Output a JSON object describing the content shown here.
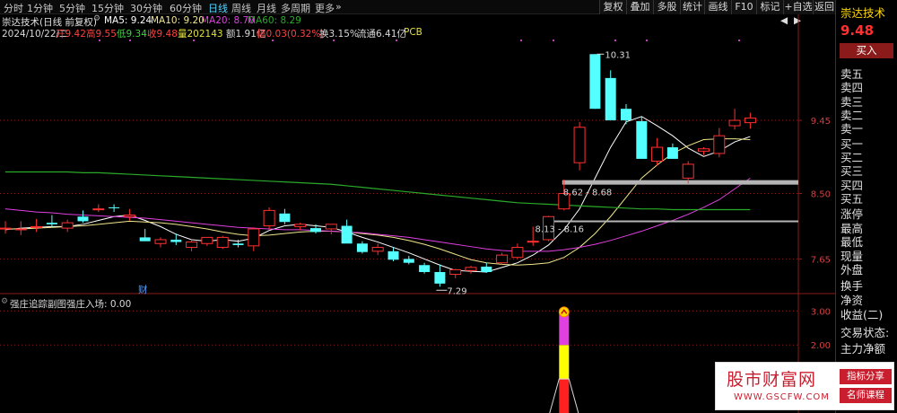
{
  "toolbar": {
    "periods": [
      "分时",
      "1分钟",
      "5分钟",
      "15分钟",
      "30分钟",
      "60分钟",
      "日线",
      "周线",
      "月线",
      "多周期",
      "更多"
    ],
    "active_period": "日线",
    "more_arrow": "»",
    "buttons": [
      "复权",
      "叠加",
      "多股",
      "统计",
      "画线",
      "F10",
      "标记",
      "+自选",
      "返回"
    ],
    "nav_arrows": [
      "◀",
      "▶"
    ]
  },
  "header": {
    "stock": "崇达技术(日线 前复权)",
    "ma5": "MA5: 9.24",
    "ma10": "MA10: 9.20",
    "ma20": "MA20: 8.70",
    "ma60": "MA60: 8.29",
    "date": "2024/10/22/二",
    "open": "开9.42",
    "high": "高9.55",
    "low": "低9.34",
    "close": "收9.48",
    "volume": "量202143",
    "amount": "额1.91亿",
    "change": "幅0.03(0.32%)",
    "turnover": "换3.15%",
    "float": "流通6.41亿",
    "sector": "PCB"
  },
  "chart_data": [
    {
      "type": "candlestick",
      "title": "崇达技术(日线 前复权)",
      "ylim": [
        7.2,
        10.5
      ],
      "y_ticks": [
        "9.45",
        "8.50",
        "7.65"
      ],
      "y_tick_values": [
        9.45,
        8.5,
        7.65
      ],
      "candles": [
        {
          "o": 8.05,
          "h": 8.14,
          "l": 7.98,
          "c": 8.05
        },
        {
          "o": 8.04,
          "h": 8.14,
          "l": 7.96,
          "c": 8.04
        },
        {
          "o": 8.07,
          "h": 8.17,
          "l": 8.0,
          "c": 8.07
        },
        {
          "o": 8.12,
          "h": 8.22,
          "l": 8.06,
          "c": 8.1
        },
        {
          "o": 8.05,
          "h": 8.16,
          "l": 8.0,
          "c": 8.12
        },
        {
          "o": 8.2,
          "h": 8.28,
          "l": 8.12,
          "c": 8.14
        },
        {
          "o": 8.3,
          "h": 8.36,
          "l": 8.26,
          "c": 8.3
        },
        {
          "o": 8.32,
          "h": 8.36,
          "l": 8.26,
          "c": 8.31
        },
        {
          "o": 8.2,
          "h": 8.3,
          "l": 8.15,
          "c": 8.22
        },
        {
          "o": 7.93,
          "h": 8.04,
          "l": 7.9,
          "c": 7.88
        },
        {
          "o": 7.85,
          "h": 7.93,
          "l": 7.8,
          "c": 7.9
        },
        {
          "o": 7.9,
          "h": 7.98,
          "l": 7.83,
          "c": 7.87
        },
        {
          "o": 7.8,
          "h": 7.9,
          "l": 7.75,
          "c": 7.87
        },
        {
          "o": 7.85,
          "h": 7.93,
          "l": 7.82,
          "c": 7.93
        },
        {
          "o": 7.8,
          "h": 7.95,
          "l": 7.78,
          "c": 7.93
        },
        {
          "o": 7.85,
          "h": 7.9,
          "l": 7.8,
          "c": 7.83
        },
        {
          "o": 7.82,
          "h": 8.06,
          "l": 7.75,
          "c": 8.04
        },
        {
          "o": 8.08,
          "h": 8.32,
          "l": 8.03,
          "c": 8.28
        },
        {
          "o": 8.24,
          "h": 8.3,
          "l": 8.1,
          "c": 8.13
        },
        {
          "o": 8.07,
          "h": 8.12,
          "l": 8.02,
          "c": 8.1
        },
        {
          "o": 8.05,
          "h": 8.1,
          "l": 7.98,
          "c": 8.0
        },
        {
          "o": 8.04,
          "h": 8.1,
          "l": 7.97,
          "c": 8.1
        },
        {
          "o": 8.08,
          "h": 8.16,
          "l": 7.9,
          "c": 7.85
        },
        {
          "o": 7.85,
          "h": 7.88,
          "l": 7.72,
          "c": 7.74
        },
        {
          "o": 7.75,
          "h": 7.85,
          "l": 7.7,
          "c": 7.8
        },
        {
          "o": 7.75,
          "h": 7.8,
          "l": 7.62,
          "c": 7.64
        },
        {
          "o": 7.65,
          "h": 7.69,
          "l": 7.58,
          "c": 7.6
        },
        {
          "o": 7.57,
          "h": 7.6,
          "l": 7.46,
          "c": 7.48
        },
        {
          "o": 7.48,
          "h": 7.58,
          "l": 7.29,
          "c": 7.33
        },
        {
          "o": 7.45,
          "h": 7.52,
          "l": 7.4,
          "c": 7.51
        },
        {
          "o": 7.5,
          "h": 7.56,
          "l": 7.46,
          "c": 7.54
        },
        {
          "o": 7.55,
          "h": 7.6,
          "l": 7.47,
          "c": 7.48
        },
        {
          "o": 7.6,
          "h": 7.73,
          "l": 7.58,
          "c": 7.7
        },
        {
          "o": 7.67,
          "h": 7.85,
          "l": 7.65,
          "c": 7.8
        },
        {
          "o": 7.88,
          "h": 8.07,
          "l": 7.82,
          "c": 7.88
        },
        {
          "o": 7.9,
          "h": 8.21,
          "l": 7.88,
          "c": 8.2
        },
        {
          "o": 8.3,
          "h": 8.68,
          "l": 8.28,
          "c": 8.5
        },
        {
          "o": 8.9,
          "h": 9.43,
          "l": 8.8,
          "c": 9.36
        },
        {
          "o": 10.31,
          "h": 10.31,
          "l": 9.6,
          "c": 9.6
        },
        {
          "o": 10.0,
          "h": 10.1,
          "l": 9.45,
          "c": 9.45
        },
        {
          "o": 9.6,
          "h": 9.66,
          "l": 9.4,
          "c": 9.45
        },
        {
          "o": 9.44,
          "h": 9.5,
          "l": 8.95,
          "c": 8.95
        },
        {
          "o": 8.92,
          "h": 9.22,
          "l": 8.86,
          "c": 9.1
        },
        {
          "o": 9.1,
          "h": 9.15,
          "l": 8.95,
          "c": 8.95
        },
        {
          "o": 8.7,
          "h": 8.92,
          "l": 8.63,
          "c": 8.88
        },
        {
          "o": 9.05,
          "h": 9.1,
          "l": 9.0,
          "c": 9.08
        },
        {
          "o": 9.02,
          "h": 9.35,
          "l": 8.97,
          "c": 9.25
        },
        {
          "o": 9.38,
          "h": 9.6,
          "l": 9.33,
          "c": 9.45
        },
        {
          "o": 9.42,
          "h": 9.55,
          "l": 9.34,
          "c": 9.48
        }
      ],
      "ma_series": [
        {
          "name": "MA5",
          "color": "#ffffff",
          "values": [
            8.03,
            8.05,
            8.06,
            8.07,
            8.07,
            8.1,
            8.15,
            8.2,
            8.22,
            8.15,
            8.07,
            7.97,
            7.9,
            7.88,
            7.9,
            7.88,
            7.92,
            8.02,
            8.08,
            8.1,
            8.08,
            8.06,
            8.0,
            7.93,
            7.87,
            7.8,
            7.73,
            7.65,
            7.57,
            7.5,
            7.49,
            7.48,
            7.54,
            7.6,
            7.7,
            7.83,
            8.03,
            8.3,
            8.7,
            9.1,
            9.43,
            9.5,
            9.38,
            9.25,
            9.09,
            8.98,
            9.05,
            9.17,
            9.24
          ]
        },
        {
          "name": "MA10",
          "color": "#f0e68c",
          "values": [
            8.04,
            8.04,
            8.05,
            8.06,
            8.07,
            8.08,
            8.1,
            8.12,
            8.14,
            8.13,
            8.12,
            8.1,
            8.07,
            8.04,
            8.0,
            7.97,
            7.95,
            7.96,
            7.98,
            8.0,
            8.01,
            8.01,
            8.0,
            7.98,
            7.96,
            7.93,
            7.89,
            7.84,
            7.78,
            7.71,
            7.64,
            7.6,
            7.58,
            7.57,
            7.58,
            7.6,
            7.67,
            7.8,
            7.98,
            8.2,
            8.45,
            8.7,
            8.87,
            9.02,
            9.12,
            9.2,
            9.21,
            9.21,
            9.2
          ]
        },
        {
          "name": "MA20",
          "color": "#e040e0",
          "values": [
            8.3,
            8.28,
            8.26,
            8.25,
            8.23,
            8.22,
            8.21,
            8.2,
            8.19,
            8.18,
            8.16,
            8.14,
            8.12,
            8.1,
            8.08,
            8.06,
            8.05,
            8.04,
            8.03,
            8.03,
            8.02,
            8.01,
            8.0,
            7.99,
            7.97,
            7.95,
            7.93,
            7.9,
            7.87,
            7.84,
            7.81,
            7.78,
            7.76,
            7.75,
            7.75,
            7.75,
            7.77,
            7.8,
            7.84,
            7.89,
            7.95,
            8.01,
            8.08,
            8.15,
            8.23,
            8.32,
            8.42,
            8.56,
            8.7
          ]
        },
        {
          "name": "MA60",
          "color": "#2aaa2a",
          "values": [
            8.78,
            8.78,
            8.78,
            8.78,
            8.78,
            8.77,
            8.77,
            8.76,
            8.75,
            8.74,
            8.73,
            8.72,
            8.71,
            8.7,
            8.69,
            8.68,
            8.67,
            8.66,
            8.65,
            8.64,
            8.63,
            8.62,
            8.6,
            8.58,
            8.56,
            8.54,
            8.52,
            8.5,
            8.48,
            8.46,
            8.44,
            8.42,
            8.4,
            8.38,
            8.37,
            8.36,
            8.35,
            8.34,
            8.33,
            8.32,
            8.31,
            8.3,
            8.3,
            8.29,
            8.29,
            8.29,
            8.29,
            8.29,
            8.29
          ]
        }
      ],
      "annotations": [
        "10.31",
        "7.29",
        "8.62 - 8.68",
        "8.13 - 8.16"
      ],
      "levels": [
        8.65,
        8.15
      ],
      "event_marker": "财"
    },
    {
      "type": "bar",
      "title": "强庄追踪副图",
      "subtitle": "强庄入场: 0.00",
      "ylim": [
        0,
        3.3
      ],
      "y_ticks": [
        "3.00",
        "2.00"
      ],
      "y_tick_values": [
        3,
        2
      ],
      "signal_index": 36,
      "signal_segments": [
        {
          "from": 0,
          "to": 1,
          "color": "#ff2020"
        },
        {
          "from": 1,
          "to": 2,
          "color": "#ffff00"
        },
        {
          "from": 2,
          "to": 3,
          "color": "#e040e0"
        }
      ]
    }
  ],
  "right_panel": {
    "stock_name": "崇达技术",
    "price": "9.48",
    "buy_button": "买入",
    "rows": [
      "卖五",
      "卖四",
      "卖三",
      "卖二",
      "卖一",
      "买一",
      "买二",
      "买三",
      "买四",
      "买五",
      "涨停",
      "最高",
      "最低",
      "现量",
      "外盘",
      "换手",
      "净资",
      "收益(二)",
      "交易状态:",
      "主力净额"
    ]
  },
  "watermark": {
    "title": "股市财富网",
    "url": "WWW.GSCFW.COM",
    "tag1": "指标分享",
    "tag2": "名师课程"
  },
  "colors": {
    "up": "#ff3030",
    "down": "#54ffff",
    "grid": "#8b1a1a",
    "level_line": "#b4b4b4"
  }
}
